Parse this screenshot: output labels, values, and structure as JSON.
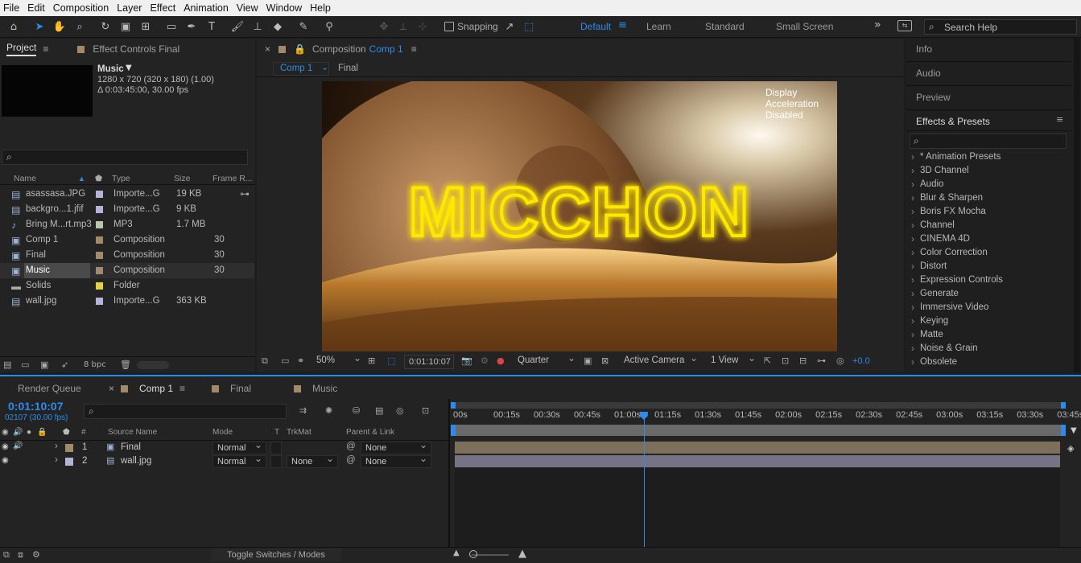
{
  "menubar": {
    "items": [
      "File",
      "Edit",
      "Composition",
      "Layer",
      "Effect",
      "Animation",
      "View",
      "Window",
      "Help"
    ]
  },
  "toolbar": {
    "snapping_label": "Snapping",
    "workspaces": [
      "Default",
      "Learn",
      "Standard",
      "Small Screen"
    ],
    "active_workspace": "Default",
    "search_placeholder": "Search Help"
  },
  "project": {
    "tab_project": "Project",
    "tab_effect_controls": "Effect Controls Final",
    "selected": {
      "name": "Music",
      "dims": "1280 x 720  (320 x 180) (1.00)",
      "duration": "Δ 0:03:45:00, 30.00 fps"
    },
    "columns": {
      "name": "Name",
      "type": "Type",
      "size": "Size",
      "frame_rate": "Frame R..."
    },
    "items": [
      {
        "name": "asassasa.JPG",
        "type": "Importe...G",
        "size": "19 KB",
        "fps": "",
        "label": "#b4b4d8",
        "icon": "image-icon"
      },
      {
        "name": "backgro...1.jfif",
        "type": "Importe...G",
        "size": "9 KB",
        "fps": "",
        "label": "#b4b4d8",
        "icon": "image-icon"
      },
      {
        "name": "Bring M...rt.mp3",
        "type": "MP3",
        "size": "1.7 MB",
        "fps": "",
        "label": "#b7c8a8",
        "icon": "audio-icon"
      },
      {
        "name": "Comp 1",
        "type": "Composition",
        "size": "",
        "fps": "30",
        "label": "#a08a6a",
        "icon": "composition-icon"
      },
      {
        "name": "Final",
        "type": "Composition",
        "size": "",
        "fps": "30",
        "label": "#a08a6a",
        "icon": "composition-icon"
      },
      {
        "name": "Music",
        "type": "Composition",
        "size": "",
        "fps": "30",
        "label": "#a08a6a",
        "icon": "composition-icon",
        "selected": true
      },
      {
        "name": "Solids",
        "type": "Folder",
        "size": "",
        "fps": "",
        "label": "#e6d23c",
        "icon": "folder-icon"
      },
      {
        "name": "wall.jpg",
        "type": "Importe...G",
        "size": "363 KB",
        "fps": "",
        "label": "#b4b4d8",
        "icon": "image-icon"
      }
    ],
    "bpc": "8 bpc"
  },
  "composition": {
    "prefix": "Composition",
    "name": "Comp 1",
    "breadcrumb": [
      "Comp 1",
      "Final"
    ],
    "viewer_text": "MICCHON",
    "notice": "Display Acceleration Disabled",
    "zoom": "50%",
    "timecode": "0:01:10:07",
    "resolution": "Quarter",
    "camera": "Active Camera",
    "views": "1 View",
    "exposure": "+0.0"
  },
  "right": {
    "tabs": [
      "Info",
      "Audio",
      "Preview"
    ],
    "effects_title": "Effects & Presets",
    "effects": [
      "* Animation Presets",
      "3D Channel",
      "Audio",
      "Blur & Sharpen",
      "Boris FX Mocha",
      "Channel",
      "CINEMA 4D",
      "Color Correction",
      "Distort",
      "Expression Controls",
      "Generate",
      "Immersive Video",
      "Keying",
      "Matte",
      "Noise & Grain",
      "Obsolete"
    ]
  },
  "timeline": {
    "tabs": [
      "Render Queue",
      "Comp 1",
      "Final",
      "Music"
    ],
    "timecode": "0:01:10:07",
    "frames": "02107 (30.00 fps)",
    "columns": {
      "num": "#",
      "source": "Source Name",
      "mode": "Mode",
      "t": "T",
      "trkmat": "TrkMat",
      "parent": "Parent & Link"
    },
    "layers": [
      {
        "num": "1",
        "name": "Final",
        "mode": "Normal",
        "trkmat": "",
        "parent": "None",
        "label": "#a08a6a"
      },
      {
        "num": "2",
        "name": "wall.jpg",
        "mode": "Normal",
        "trkmat": "None",
        "parent": "None",
        "label": "#b4b4d8"
      }
    ],
    "ruler": [
      "00s",
      "00:15s",
      "00:30s",
      "00:45s",
      "01:00s",
      "01:15s",
      "01:30s",
      "01:45s",
      "02:00s",
      "02:15s",
      "02:30s",
      "02:45s",
      "03:00s",
      "03:15s",
      "03:30s",
      "03:45s"
    ],
    "toggle_label": "Toggle Switches / Modes",
    "current_time_fraction": 0.311
  },
  "colors": {
    "accent": "#2d8ceb",
    "glow": "#ffe800"
  }
}
